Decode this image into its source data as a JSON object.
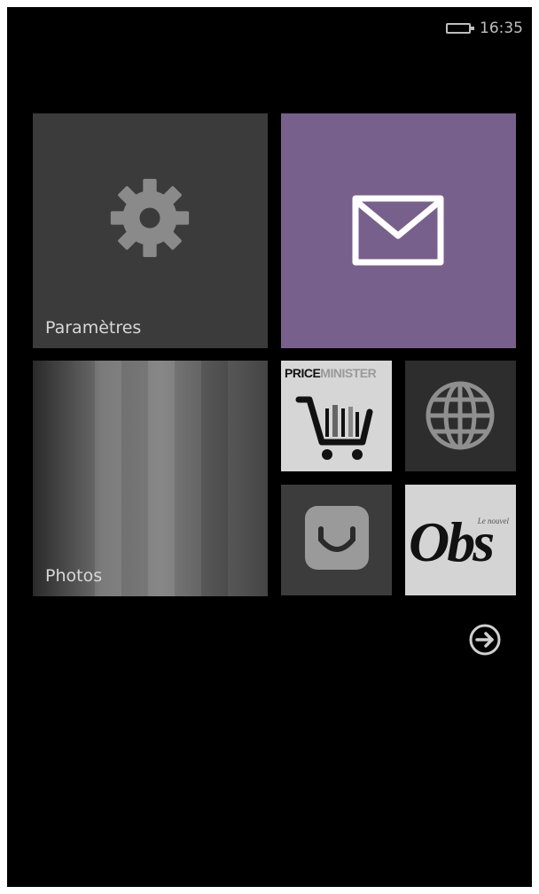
{
  "status_bar": {
    "time": "16:35",
    "battery_icon": "battery-icon"
  },
  "tiles": {
    "settings": {
      "label": "Paramètres",
      "icon": "gear-icon",
      "color": "#3b3b3b"
    },
    "mail": {
      "icon": "envelope-icon",
      "color": "#78608c"
    },
    "photos": {
      "label": "Photos",
      "color": "#6d6d6d"
    },
    "priceminister": {
      "title_part1": "PRICE",
      "title_part2": "MINISTER",
      "icon": "shopping-cart-icon"
    },
    "browser": {
      "icon": "globe-icon"
    },
    "smile": {
      "icon": "smiley-icon"
    },
    "obs": {
      "wordmark": "Obs",
      "tagline": "Le nouvel"
    }
  },
  "navigation": {
    "app_list_button": "arrow-right-circle-icon"
  }
}
